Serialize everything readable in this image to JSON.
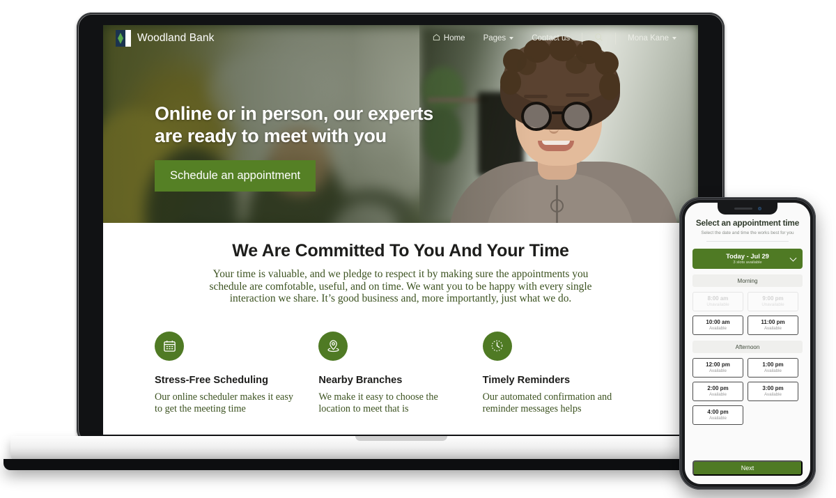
{
  "site": {
    "brand": "Woodland Bank",
    "logo_icon": "woodland-bank-logo",
    "nav": [
      {
        "label": "Home",
        "icon": "home-icon",
        "has_caret": false
      },
      {
        "label": "Pages",
        "icon": "",
        "has_caret": true
      },
      {
        "label": "Contact us",
        "icon": "",
        "has_caret": false
      }
    ],
    "search_icon": "search-icon",
    "account": {
      "label": "Mona Kane",
      "has_caret": true
    }
  },
  "hero": {
    "headline_line1": "Online or in person, our experts",
    "headline_line2": "are ready to meet with you",
    "cta": "Schedule an appointment"
  },
  "main": {
    "heading": "We Are Committed To You And Your Time",
    "paragraph": "Your time is valuable, and we pledge to respect it by making sure the appointments you schedule are comfotable, useful, and on time. We want you to be happy with every single interaction we share. It’s good business and, more importantly, just what we do.",
    "features": [
      {
        "icon": "calendar-icon",
        "title": "Stress-Free Scheduling",
        "text": "Our online scheduler makes it easy to get the meeting time"
      },
      {
        "icon": "map-pin-icon",
        "title": "Nearby Branches",
        "text": "We make it easy to choose the location to meet that is"
      },
      {
        "icon": "clock-icon",
        "title": "Timely Reminders",
        "text": "Our automated confirmation and reminder messages helps"
      }
    ]
  },
  "phone": {
    "title": "Select an appointment time",
    "subtitle": "Select the date and time the works best for you",
    "date_selector": {
      "label": "Today - Jul 29",
      "sublabel": "3 slots available",
      "caret_icon": "chevron-down-icon"
    },
    "sections": [
      {
        "name": "Morning",
        "slots": [
          {
            "time": "8:00 am",
            "status": "Unavailable",
            "available": false
          },
          {
            "time": "9:00 pm",
            "status": "Unavailable",
            "available": false
          },
          {
            "time": "10:00 am",
            "status": "Available",
            "available": true
          },
          {
            "time": "11:00 pm",
            "status": "Available",
            "available": true
          }
        ]
      },
      {
        "name": "Afternoon",
        "slots": [
          {
            "time": "12:00 pm",
            "status": "Available",
            "available": true
          },
          {
            "time": "1:00 pm",
            "status": "Available",
            "available": true
          },
          {
            "time": "2:00 pm",
            "status": "Available",
            "available": true
          },
          {
            "time": "3:00 pm",
            "status": "Available",
            "available": true
          },
          {
            "time": "4:00 pm",
            "status": "Available",
            "available": true
          }
        ]
      }
    ],
    "next_button": "Next"
  },
  "colors": {
    "brand_green": "#4f7a24",
    "text_green": "#3c5220",
    "dark_text": "#1d1d1b",
    "hero_overlay": "#1e2a12"
  }
}
